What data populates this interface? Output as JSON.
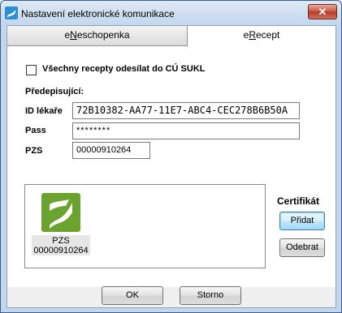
{
  "window": {
    "title": "Nastavení elektronické komunikace",
    "close_glyph": "✕"
  },
  "tabs": [
    {
      "label_prefix": "e",
      "label_accel": "N",
      "label_rest": "eschopenka",
      "active": false
    },
    {
      "label_prefix": "e",
      "label_accel": "R",
      "label_rest": "ecept",
      "active": true
    }
  ],
  "erecept": {
    "send_all_checkbox": {
      "label": "Všechny recepty odesílat do CÚ SUKL",
      "checked": false
    },
    "prescriber_section": "Předepisující:",
    "fields": {
      "doctor_id": {
        "label": "ID lékaře",
        "value": "72B10382-AA77-11E7-ABC4-CEC278B6B50A"
      },
      "pass": {
        "label": "Pass",
        "value": "********"
      },
      "pzs": {
        "label": "PZS",
        "value": "00000910264"
      }
    },
    "certificates": {
      "title": "Certifikát",
      "items": [
        {
          "line1": "PZS",
          "line2": "00000910264",
          "icon": "certificate-logo-icon",
          "color": "#6aa42f"
        }
      ],
      "add_label": "Přidat",
      "remove_label": "Odebrat"
    }
  },
  "footer": {
    "ok_label": "OK",
    "cancel_label": "Storno"
  }
}
